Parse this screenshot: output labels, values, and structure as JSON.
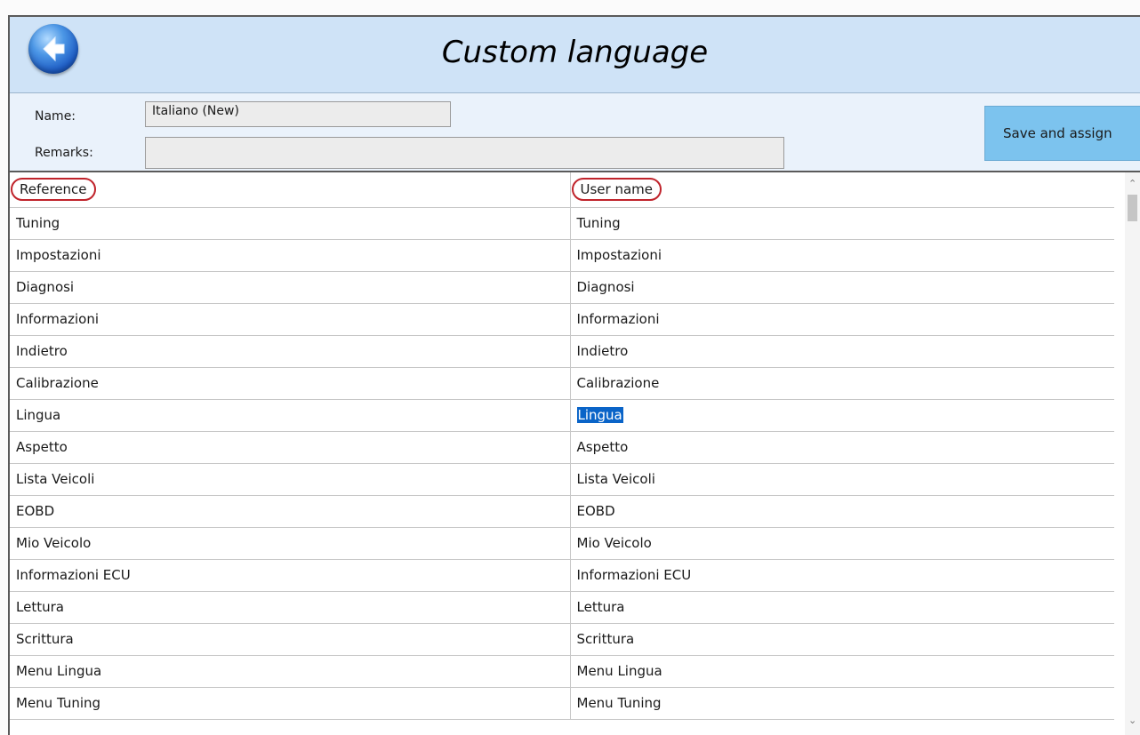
{
  "header": {
    "title": "Custom language"
  },
  "form": {
    "name_label": "Name:",
    "name_value": "Italiano (New)",
    "remarks_label": "Remarks:",
    "remarks_value": "",
    "save_label": "Save and assign"
  },
  "table": {
    "columns": [
      "Reference",
      "User name"
    ],
    "rows": [
      [
        "Tuning",
        "Tuning"
      ],
      [
        "Impostazioni",
        "Impostazioni"
      ],
      [
        "Diagnosi",
        "Diagnosi"
      ],
      [
        "Informazioni",
        "Informazioni"
      ],
      [
        "Indietro",
        "Indietro"
      ],
      [
        "Calibrazione",
        "Calibrazione"
      ],
      [
        "Lingua",
        "Lingua"
      ],
      [
        "Aspetto",
        "Aspetto"
      ],
      [
        "Lista Veicoli",
        "Lista Veicoli"
      ],
      [
        "EOBD",
        "EOBD"
      ],
      [
        "Mio Veicolo",
        "Mio Veicolo"
      ],
      [
        "Informazioni ECU",
        "Informazioni ECU"
      ],
      [
        "Lettura",
        "Lettura"
      ],
      [
        "Scrittura",
        "Scrittura"
      ],
      [
        "Menu Lingua",
        "Menu Lingua"
      ],
      [
        "Menu Tuning",
        "Menu Tuning"
      ]
    ],
    "selected_row": 6
  },
  "colors": {
    "title_bar": "#cfe3f7",
    "save_button": "#7cc3ee",
    "selection": "#0a64c8",
    "highlight_circle": "#c0232b"
  },
  "icons": {
    "back": "arrow-left-circle-icon"
  }
}
